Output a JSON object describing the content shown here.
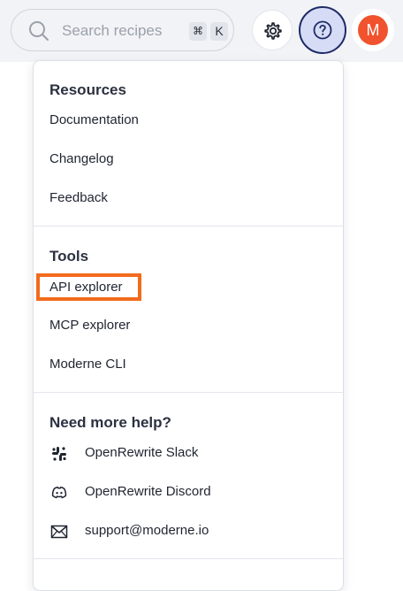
{
  "search": {
    "placeholder": "Search recipes",
    "shortcut_modifier": "⌘",
    "shortcut_key": "K"
  },
  "header": {
    "settings_icon": "gear-icon",
    "help_icon": "question-circle-icon",
    "avatar_initial": "M"
  },
  "menu": {
    "resources": {
      "title": "Resources",
      "items": [
        "Documentation",
        "Changelog",
        "Feedback"
      ]
    },
    "tools": {
      "title": "Tools",
      "items": [
        "API explorer",
        "MCP explorer",
        "Moderne CLI"
      ],
      "highlighted": "API explorer"
    },
    "help": {
      "title": "Need more help?",
      "items": [
        {
          "label": "OpenRewrite Slack",
          "icon": "slack-icon"
        },
        {
          "label": "OpenRewrite Discord",
          "icon": "discord-icon"
        },
        {
          "label": "support@moderne.io",
          "icon": "mail-icon"
        }
      ]
    }
  },
  "colors": {
    "accent_border": "#1d2a66",
    "help_bg": "#d7dcf6",
    "avatar_bg": "#f0532d",
    "highlight": "#f26b1d"
  }
}
